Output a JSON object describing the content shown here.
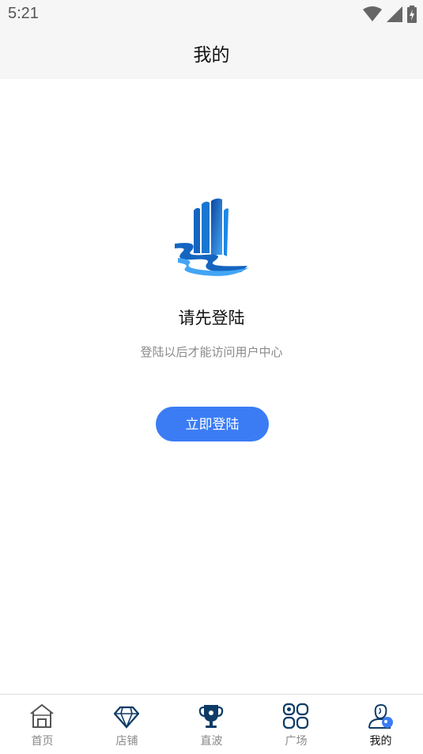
{
  "status_bar": {
    "time": "5:21",
    "icons": [
      "wifi-icon",
      "cell-signal-icon",
      "battery-charging-icon"
    ]
  },
  "header": {
    "title": "我的"
  },
  "main": {
    "logo_icon": "building-river-logo",
    "title": "请先登陆",
    "subtitle": "登陆以后才能访问用户中心",
    "login_button": "立即登陆"
  },
  "tab_bar": {
    "active_index": 4,
    "accent_color": "#3b7cf5",
    "items": [
      {
        "label": "首页",
        "icon": "home-icon"
      },
      {
        "label": "店铺",
        "icon": "diamond-icon"
      },
      {
        "label": "直波",
        "icon": "trophy-icon"
      },
      {
        "label": "广场",
        "icon": "grid-icon"
      },
      {
        "label": "我的",
        "icon": "user-icon"
      }
    ]
  }
}
